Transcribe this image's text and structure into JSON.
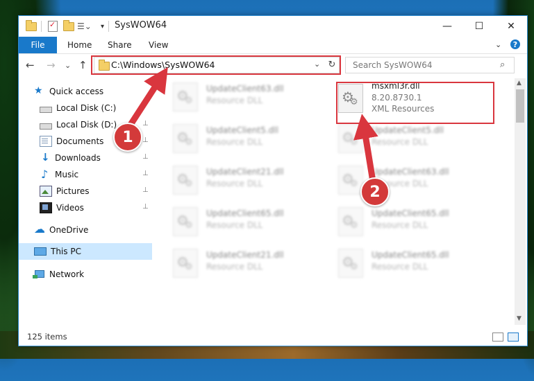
{
  "window": {
    "title": "SysWOW64",
    "controls": {
      "minimize": "—",
      "maximize": "☐",
      "close": "✕"
    }
  },
  "ribbon": {
    "tabs": [
      "File",
      "Home",
      "Share",
      "View"
    ],
    "collapse_chevron": "⌄",
    "help": "?"
  },
  "nav": {
    "back": "←",
    "forward": "→",
    "recent": "⌄",
    "up": "↑",
    "address": "C:\\Windows\\SysWOW64",
    "address_dropdown": "⌄",
    "refresh": "↻",
    "search_placeholder": "Search SysWOW64",
    "search_icon": "⌕"
  },
  "sidebar": {
    "items": [
      {
        "label": "Quick access",
        "icon": "star-icon",
        "pinned": false
      },
      {
        "label": "Local Disk (C:)",
        "icon": "disk-icon",
        "pinned": false
      },
      {
        "label": "Local Disk (D:)",
        "icon": "disk-icon",
        "pinned": true
      },
      {
        "label": "Documents",
        "icon": "documents-icon",
        "pinned": true
      },
      {
        "label": "Downloads",
        "icon": "downloads-icon",
        "pinned": true
      },
      {
        "label": "Music",
        "icon": "music-icon",
        "pinned": true
      },
      {
        "label": "Pictures",
        "icon": "pictures-icon",
        "pinned": true
      },
      {
        "label": "Videos",
        "icon": "videos-icon",
        "pinned": true
      },
      {
        "label": "OneDrive",
        "icon": "onedrive-icon",
        "pinned": false
      },
      {
        "label": "This PC",
        "icon": "pc-icon",
        "pinned": false,
        "selected": true
      },
      {
        "label": "Network",
        "icon": "network-icon",
        "pinned": false
      }
    ],
    "pin_glyph": "📌"
  },
  "files": {
    "left": [
      {
        "name": "UpdateClient63.dll",
        "type": "Resource DLL"
      },
      {
        "name": "UpdateClient5.dll",
        "type": "Resource DLL"
      },
      {
        "name": "UpdateClient21.dll",
        "type": "Resource DLL"
      },
      {
        "name": "UpdateClient65.dll",
        "type": "Resource DLL"
      },
      {
        "name": "UpdateClient21.dll",
        "type": "Resource DLL"
      }
    ],
    "right": [
      {
        "name": "msxml3r.dll",
        "version": "8.20.8730.1",
        "type": "XML Resources"
      },
      {
        "name": "UpdateClient5.dll",
        "type": "Resource DLL"
      },
      {
        "name": "UpdateClient63.dll",
        "type": "Resource DLL"
      },
      {
        "name": "UpdateClient65.dll",
        "type": "Resource DLL"
      },
      {
        "name": "UpdateClient65.dll",
        "type": "Resource DLL"
      }
    ]
  },
  "status": {
    "count": "125 items"
  },
  "annotations": {
    "step1": "1",
    "step2": "2",
    "color": "#d9363e"
  }
}
